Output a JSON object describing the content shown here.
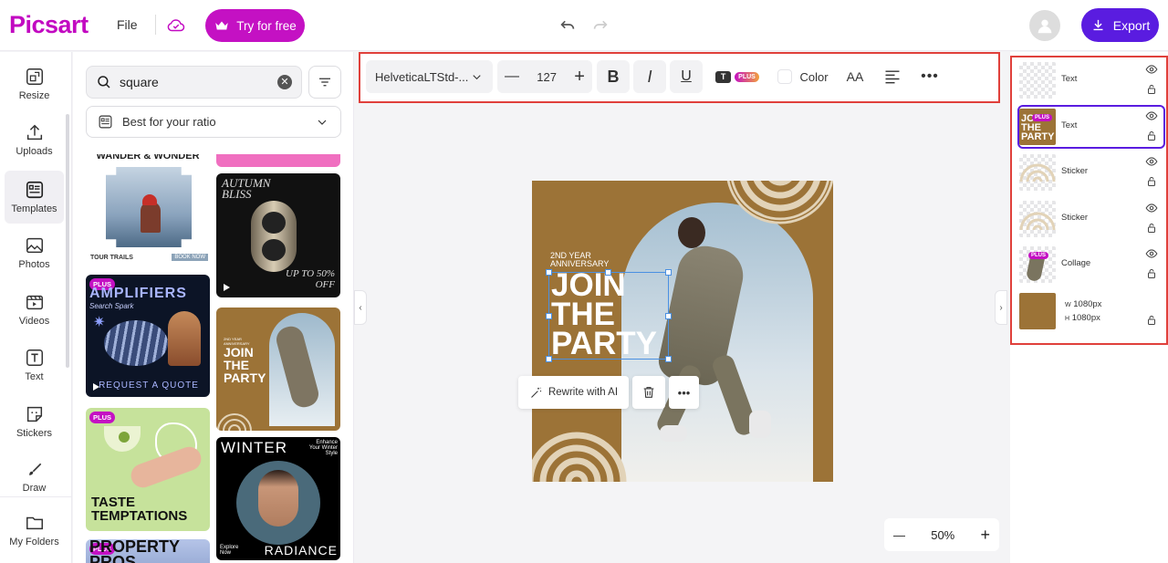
{
  "app": {
    "logo": "Picsart",
    "file_menu": "File",
    "try_label": "Try for free",
    "export_label": "Export"
  },
  "rail": [
    {
      "label": "Resize",
      "icon": "resize-icon"
    },
    {
      "label": "Uploads",
      "icon": "upload-icon"
    },
    {
      "label": "Templates",
      "icon": "templates-icon",
      "active": true
    },
    {
      "label": "Photos",
      "icon": "photos-icon"
    },
    {
      "label": "Videos",
      "icon": "videos-icon"
    },
    {
      "label": "Text",
      "icon": "text-icon"
    },
    {
      "label": "Stickers",
      "icon": "stickers-icon"
    },
    {
      "label": "Draw",
      "icon": "brush-icon"
    },
    {
      "label": "My Folders",
      "icon": "folder-icon"
    }
  ],
  "panel": {
    "search_value": "square",
    "ratio_label": "Best for your ratio",
    "templates": [
      {
        "id": "tour",
        "title": "WANDER & WONDER",
        "caption": "TOUR TRAILS",
        "cta": "BOOK NOW"
      },
      {
        "id": "autumn",
        "title": "AUTUMN BLISS",
        "subtitle": "UP TO 50% OFF"
      },
      {
        "id": "amplifiers",
        "badge": "PLUS",
        "title": "AMPLIFIERS",
        "subtitle": "Search Spark",
        "cta": "REQUEST A QUOTE"
      },
      {
        "id": "party",
        "eyebrow": "2ND YEAR ANNIVERSARY",
        "title": "JOIN THE PARTY"
      },
      {
        "id": "taste",
        "badge": "PLUS",
        "title": "TASTE TEMPTATIONS"
      },
      {
        "id": "winter",
        "title": "WINTER",
        "side": "Enhance Your Winter Style",
        "corner": "Explore Now",
        "bottom": "RADIANCE"
      },
      {
        "id": "property",
        "badge": "PLUS",
        "title": "PROPERTY PROS"
      }
    ]
  },
  "toolbar": {
    "font": "HelveticaLTStd-...",
    "font_size": "127",
    "bold": "B",
    "italic": "I",
    "underline": "U",
    "effect_badge": "PLUS",
    "color_label": "Color",
    "case_label": "AA",
    "more": "•••"
  },
  "artboard": {
    "eyebrow_line1": "2ND YEAR",
    "eyebrow_line2": "ANNIVERSARY",
    "title_lines": [
      "JOIN",
      "THE",
      "PARTY"
    ],
    "bg": "#9c7337"
  },
  "context_menu": {
    "rewrite_label": "Rewrite with AI"
  },
  "zoom": {
    "minus": "—",
    "value": "50%",
    "plus": "+"
  },
  "layers": [
    {
      "label": "Text"
    },
    {
      "label": "Text",
      "badge": "PLUS",
      "selected": true
    },
    {
      "label": "Sticker"
    },
    {
      "label": "Sticker"
    },
    {
      "label": "Collage",
      "badge": "PLUS"
    },
    {
      "label_w": "1080px",
      "label_h": "1080px",
      "w_tag": "W",
      "h_tag": "H"
    }
  ]
}
